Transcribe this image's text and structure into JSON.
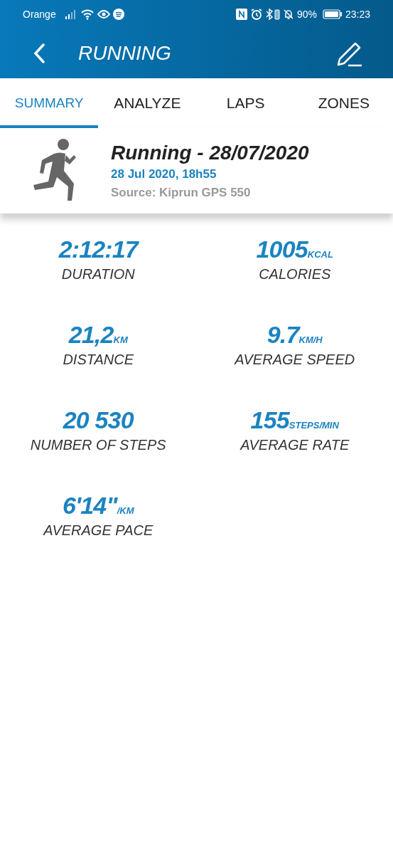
{
  "status_bar": {
    "carrier": "Orange",
    "battery": "90%",
    "time": "23:23"
  },
  "header": {
    "title": "RUNNING"
  },
  "tabs": [
    {
      "label": "SUMMARY",
      "selected": true
    },
    {
      "label": "ANALYZE",
      "selected": false
    },
    {
      "label": "LAPS",
      "selected": false
    },
    {
      "label": "ZONES",
      "selected": false
    }
  ],
  "activity": {
    "title": "Running - 28/07/2020",
    "datetime": "28 Jul 2020, 18h55",
    "source": "Source: Kiprun GPS 550"
  },
  "stats": [
    {
      "value": "2:12:17",
      "label": "DURATION"
    },
    {
      "value": "1005",
      "unit": "KCAL",
      "label": "CALORIES"
    },
    {
      "value": "21,2",
      "unit": "KM",
      "label": "DISTANCE"
    },
    {
      "value": "9.7",
      "unit": "KM/H",
      "label": "AVERAGE SPEED"
    },
    {
      "value": "20 530",
      "label": "NUMBER OF STEPS"
    },
    {
      "value": "155",
      "unit": "STEPS/MIN",
      "label": "AVERAGE RATE"
    },
    {
      "value": "6'14\"",
      "unit": "/KM",
      "label": "AVERAGE PACE"
    }
  ]
}
